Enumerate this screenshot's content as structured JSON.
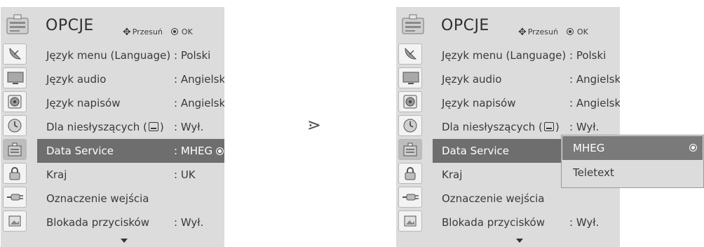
{
  "left": {
    "title": "OPCJE",
    "hint_move": "Przesuń",
    "hint_ok": "OK",
    "items": [
      {
        "label": "Język menu (Language)",
        "value": ": Polski"
      },
      {
        "label": "Język  audio",
        "value": ": Angielski"
      },
      {
        "label": "Język  napisów",
        "value": ": Angielski"
      },
      {
        "label_pre": "Dla niesłyszących (",
        "label_post": ")",
        "value": ": Wył."
      },
      {
        "label": "Data Service",
        "value": ": MHEG"
      },
      {
        "label": "Kraj",
        "value": ": UK"
      },
      {
        "label": "Oznaczenie wejścia",
        "value": ""
      },
      {
        "label": "Blokada przycisków",
        "value": ": Wył."
      }
    ]
  },
  "right": {
    "title": "OPCJE",
    "hint_move": "Przesuń",
    "hint_ok": "OK",
    "items": [
      {
        "label": "Język menu (Language)",
        "value": ": Polski"
      },
      {
        "label": "Język  audio",
        "value": ": Angielski"
      },
      {
        "label": "Język  napisów",
        "value": ": Angielski"
      },
      {
        "label_pre": "Dla niesłyszących (",
        "label_post": ")",
        "value": ": Wył."
      },
      {
        "label": "Data Service",
        "value": ":"
      },
      {
        "label": "Kraj",
        "value": ":"
      },
      {
        "label": "Oznaczenie wejścia",
        "value": ""
      },
      {
        "label": "Blokada przycisków",
        "value": ": Wył."
      }
    ],
    "popup_options": [
      "MHEG",
      "Teletext"
    ]
  },
  "next_arrow": "⋗",
  "icons": [
    "satellite-dish-icon",
    "monitor-icon",
    "speaker-icon",
    "clock-icon",
    "options-icon",
    "lock-icon",
    "input-plug-icon",
    "photo-icon"
  ]
}
